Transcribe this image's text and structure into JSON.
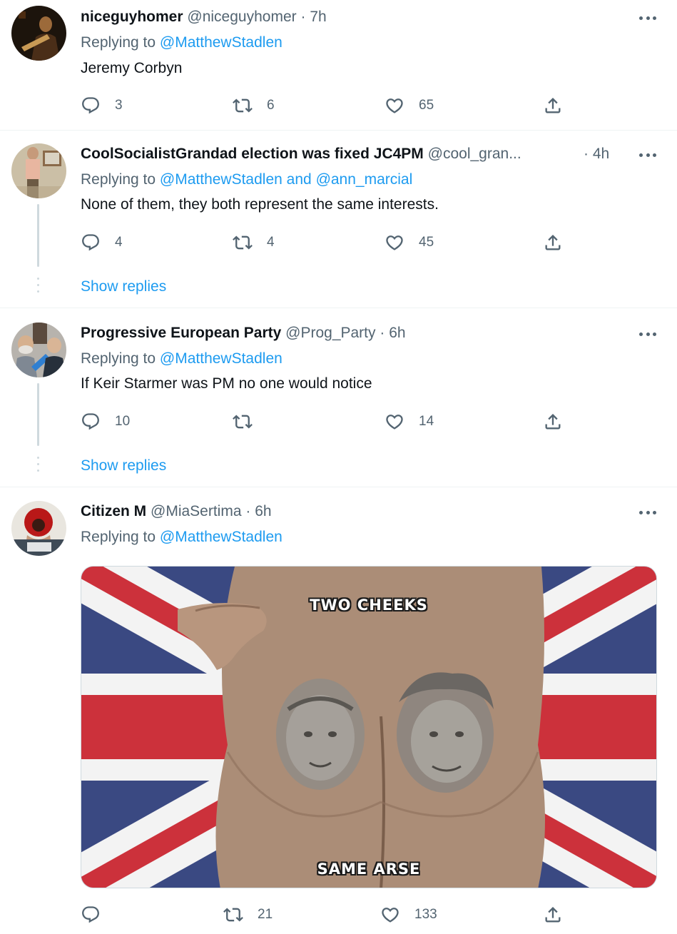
{
  "tweets": [
    {
      "name": "niceguyhomer",
      "handle": "@niceguyhomer",
      "separator": "·",
      "time": "7h",
      "replying_label": "Replying to",
      "replying_to": "@MatthewStadlen",
      "text": "Jeremy Corbyn",
      "replies": "3",
      "retweets": "6",
      "likes": "65"
    },
    {
      "name": "CoolSocialistGrandad election was fixed JC4PM",
      "handle": "@cool_gran...",
      "separator": "·",
      "time": "4h",
      "replying_label": "Replying to",
      "replying_to": "@MatthewStadlen",
      "replying_and": "and",
      "replying_to_2": "@ann_marcial",
      "text": "None of them, they both represent the same interests.",
      "replies": "4",
      "retweets": "4",
      "likes": "45",
      "show_replies": "Show replies"
    },
    {
      "name": "Progressive European Party",
      "handle": "@Prog_Party",
      "separator": "·",
      "time": "6h",
      "replying_label": "Replying to",
      "replying_to": "@MatthewStadlen",
      "text": "If Keir Starmer was PM no one would notice",
      "replies": "10",
      "retweets": "",
      "likes": "14",
      "show_replies": "Show replies"
    },
    {
      "name": "Citizen M",
      "handle": "@MiaSertima",
      "separator": "·",
      "time": "6h",
      "replying_label": "Replying to",
      "replying_to": "@MatthewStadlen",
      "media": {
        "top_caption": "TWO CHEEKS",
        "bottom_caption": "SAME ARSE"
      },
      "replies": "",
      "retweets": "21",
      "likes": "133"
    }
  ],
  "icons": {
    "reply": "reply-icon",
    "retweet": "retweet-icon",
    "like": "heart-icon",
    "share": "share-icon",
    "more": "more-icon"
  },
  "colors": {
    "link": "#1d9bf0",
    "secondary_text": "#536471",
    "divider": "#eff3f4"
  }
}
